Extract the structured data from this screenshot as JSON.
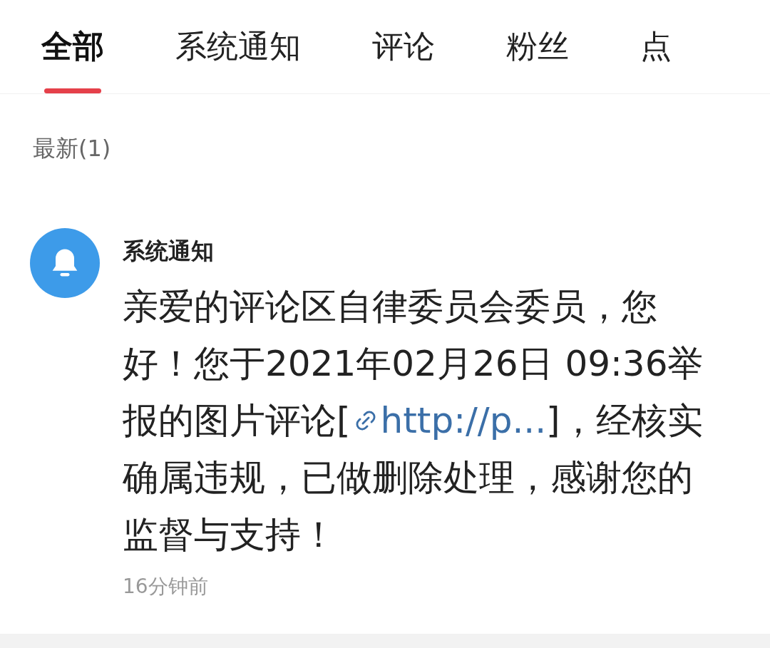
{
  "tabs": [
    {
      "label": "全部",
      "selected": true
    },
    {
      "label": "系统通知",
      "selected": false
    },
    {
      "label": "评论",
      "selected": false
    },
    {
      "label": "粉丝",
      "selected": false
    },
    {
      "label": "点",
      "selected": false
    }
  ],
  "section_label": "最新(1)",
  "notification": {
    "title": "系统通知",
    "message_before": "亲爱的评论区自律委员会委员，您好！您于2021年02月26日 09:36举报的图片评论[",
    "link": "http://p...",
    "message_after": "]，经核实确属违规，已做删除处理，感谢您的监督与支持！",
    "time": "16分钟前"
  }
}
